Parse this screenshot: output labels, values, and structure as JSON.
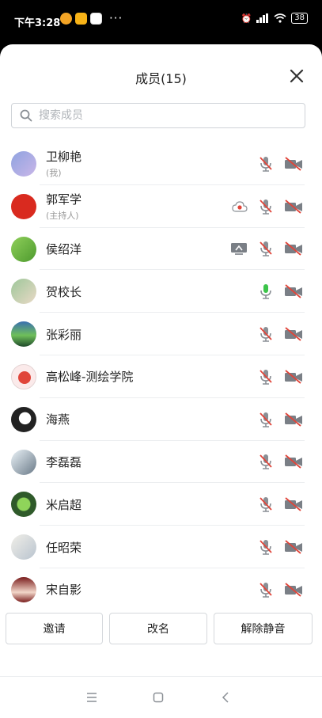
{
  "status_bar": {
    "time": "下午3:28",
    "more": "···",
    "battery": "38"
  },
  "title": "成员(15)",
  "search": {
    "placeholder": "搜索成员",
    "value": ""
  },
  "members": [
    {
      "name": "卫柳艳",
      "role": "(我)",
      "mic": "muted",
      "camera": "off",
      "extra": null
    },
    {
      "name": "郭军学",
      "role": "(主持人)",
      "mic": "muted",
      "camera": "off",
      "extra": "cloud-record-icon"
    },
    {
      "name": "侯绍洋",
      "role": "",
      "mic": "muted",
      "camera": "off",
      "extra": "screen-share-icon"
    },
    {
      "name": "贺校长",
      "role": "",
      "mic": "active",
      "camera": "off",
      "extra": null
    },
    {
      "name": "张彩丽",
      "role": "",
      "mic": "muted",
      "camera": "off",
      "extra": null
    },
    {
      "name": "高松峰-测绘学院",
      "role": "",
      "mic": "muted",
      "camera": "off",
      "extra": null
    },
    {
      "name": "海燕",
      "role": "",
      "mic": "muted",
      "camera": "off",
      "extra": null
    },
    {
      "name": "李磊磊",
      "role": "",
      "mic": "muted",
      "camera": "off",
      "extra": null
    },
    {
      "name": "米启超",
      "role": "",
      "mic": "muted",
      "camera": "off",
      "extra": null
    },
    {
      "name": "任昭荣",
      "role": "",
      "mic": "muted",
      "camera": "off",
      "extra": null
    },
    {
      "name": "宋自影",
      "role": "",
      "mic": "muted",
      "camera": "off",
      "extra": null
    }
  ],
  "actions": {
    "invite": "邀请",
    "rename": "改名",
    "unmute_all": "解除静音"
  },
  "colors": {
    "accent_green": "#3cc44a",
    "muted_red": "#e0453a",
    "icon_gray": "#7a7f86"
  }
}
